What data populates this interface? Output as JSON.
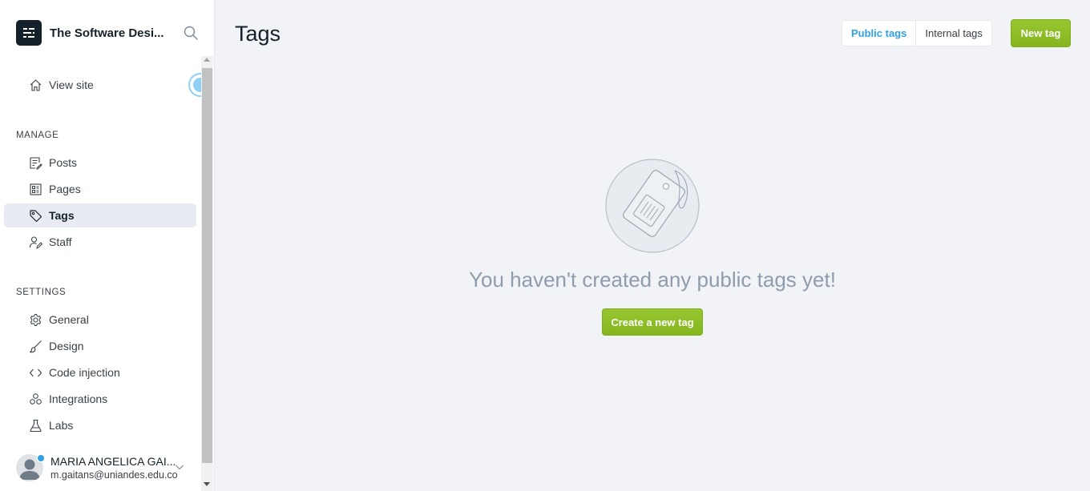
{
  "sidebar": {
    "site_title": "The Software Desi...",
    "view_site": "View site",
    "manage_label": "MANAGE",
    "manage_items": [
      {
        "label": "Posts",
        "icon": "posts-icon"
      },
      {
        "label": "Pages",
        "icon": "pages-icon"
      },
      {
        "label": "Tags",
        "icon": "tag-icon",
        "active": true
      },
      {
        "label": "Staff",
        "icon": "staff-icon"
      }
    ],
    "settings_label": "SETTINGS",
    "settings_items": [
      {
        "label": "General",
        "icon": "gear-icon"
      },
      {
        "label": "Design",
        "icon": "brush-icon"
      },
      {
        "label": "Code injection",
        "icon": "code-icon"
      },
      {
        "label": "Integrations",
        "icon": "integrations-icon"
      },
      {
        "label": "Labs",
        "icon": "flask-icon"
      }
    ],
    "user": {
      "name": "MARIA ANGELICA GAI...",
      "email": "m.gaitans@uniandes.edu.co"
    }
  },
  "main": {
    "title": "Tags",
    "tabs": [
      {
        "label": "Public tags",
        "active": true
      },
      {
        "label": "Internal tags",
        "active": false
      }
    ],
    "new_tag_label": "New tag",
    "empty_message": "You haven't created any public tags yet!",
    "create_label": "Create a new tag"
  },
  "colors": {
    "accent_green": "#8ebf25",
    "accent_blue": "#30a1e6",
    "sidebar_active_bg": "#e8ecf2",
    "page_bg": "#f1f3f7"
  }
}
